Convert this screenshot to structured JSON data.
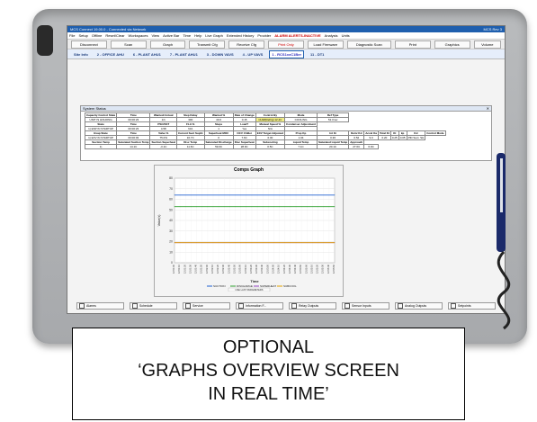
{
  "app": {
    "title": "MCS Connect 19.00.0 - Connected via Network",
    "window_right": "MCS Rev 3"
  },
  "menu": {
    "items": [
      "File",
      "Setup",
      "Offline",
      "Reset/Clear",
      "Workspaces",
      "View",
      "Active Bar",
      "Time",
      "Help",
      "Live Graph",
      "Extended History",
      "Provider"
    ],
    "alarm": "ALARM ALERTS-INACTIVE",
    "right_items": [
      "Analysis",
      "Units"
    ]
  },
  "toolbar": {
    "buttons": [
      "Disconnect",
      "Scan",
      "Graph",
      "Transmit Cfg",
      "Receive Cfg",
      "Print Only",
      "Load Firmware",
      "Diagnostic Scan",
      "Print",
      "Graphics",
      "Volume"
    ]
  },
  "sites": {
    "label": "Site Info",
    "items": [
      "2 - OFFICE AHU",
      "6 - PLANT AHU1",
      "7 - PLANT AHU1",
      "3 - DOWN VAVS",
      "4 - UP VAVS",
      "1 - RCS1xxC1Ber",
      "11 - DT1"
    ]
  },
  "status_panel": {
    "title": "System Status",
    "row1_headers": [
      "Capacity Control State",
      "Time",
      "Wanted/ Actual",
      "Step Delay",
      "Wanted %",
      "Rate of Change",
      "Control By",
      "Mode",
      "Ref Type"
    ],
    "row1_values": [
      "UNIT IS HOLDING",
      "00:00:23",
      "1/1",
      "300",
      "40.0",
      "0.15",
      "CHW(Refrig) 12.4C",
      "COOLING",
      "52.0 kw"
    ],
    "row2_headers": [
      "State",
      "Time",
      "PSC/SST",
      "FLA %",
      "Steps",
      "Load?",
      "Manual Speed %",
      "Condenser Adjustment"
    ],
    "row2_values": [
      "1) ESP IN STARTUP",
      "00:00:23",
      "4.58",
      "N/A",
      "1",
      "Yes",
      "N/A",
      ""
    ],
    "row3_headers": [
      "Evap State",
      "Time",
      "Valve %",
      "Current Suct Supht",
      "Superheat MOC",
      "OCV Chiller",
      "EXV Target Adjusted",
      "Prop Kp",
      "Int Ki",
      "Deriv Kd",
      "Accel Ka",
      "Total Kt",
      "Kt",
      "kp",
      "Kd",
      "Control Mode"
    ],
    "row3_values": [
      "1) EXV IN STARTUP",
      "00:00:03",
      "75.0%",
      "16.7C",
      "0",
      "7.6C",
      "0.00",
      "1.04",
      "0.36",
      "0.52",
      "9.0",
      "0.20",
      "0.25",
      "0.05",
      "PID Suct. SH"
    ],
    "row4_headers": [
      "Suction Temp",
      "Saturated Suction Temp",
      "Suction Superheat",
      "Disc Temp",
      "Saturated Discharge",
      "Disc Superheat",
      "Subcooling",
      "Liquid Temp",
      "Saturated Liquid Temp",
      "Approach"
    ],
    "row4_values": [
      "14.1C",
      "-3.1C",
      "11.6C",
      "59.0C",
      "28.9C",
      "0.5C",
      "7.1C",
      "20.1C",
      "27.6C",
      "6.9C"
    ],
    "row4_index": "1)"
  },
  "chart_data": {
    "type": "line",
    "title": "Comps Graph",
    "xlabel": "Time",
    "ylabel": "Value(s)",
    "x": [
      "12:51:00",
      "12:51:10",
      "12:51:20",
      "12:51:30",
      "12:51:40",
      "12:51:50",
      "12:52:00",
      "12:52:10",
      "12:52:20",
      "12:52:30",
      "12:52:40",
      "12:52:50",
      "12:53:00",
      "12:53:10",
      "12:53:20",
      "12:53:30",
      "12:53:40",
      "12:53:50",
      "12:54:00",
      "12:54:10",
      "12:54:20",
      "12:54:30",
      "12:54:40",
      "12:54:50",
      "12:55:00",
      "12:55:10",
      "12:55:20",
      "12:55:30",
      "12:55:40",
      "12:55:50"
    ],
    "series": [
      {
        "name": "SUCTION",
        "color": "#2060d0",
        "values": [
          64,
          64,
          64,
          64,
          64,
          64,
          64,
          64,
          64,
          64,
          64,
          64,
          64,
          64,
          64,
          64,
          64,
          64,
          64,
          64,
          64,
          64,
          64,
          64,
          64,
          64,
          64,
          64,
          64,
          64
        ]
      },
      {
        "name": "DISCHARGE",
        "color": "#30a030",
        "values": [
          53,
          53,
          53,
          53,
          53,
          53,
          53,
          53,
          53,
          53,
          53,
          53,
          53,
          53,
          53,
          53,
          53,
          53,
          53,
          53,
          53,
          53,
          53,
          53,
          53,
          53,
          53,
          53,
          53,
          53
        ]
      },
      {
        "name": "SUPERHEAT",
        "color": "#9040c0",
        "values": [
          19,
          19,
          19,
          19,
          19,
          19,
          19,
          19,
          19,
          19,
          19,
          19,
          19,
          19,
          19,
          19,
          19,
          19,
          19,
          19,
          19,
          19,
          19,
          19,
          19,
          19,
          19,
          19,
          19,
          19
        ]
      },
      {
        "name": "SUBCOOL",
        "color": "#e0a000",
        "values": [
          19,
          19,
          19,
          19,
          19,
          19,
          19,
          19,
          19,
          19,
          19,
          19,
          19,
          19,
          19,
          19,
          19,
          19,
          19,
          19,
          19,
          19,
          19,
          19,
          19,
          19,
          19,
          19,
          19,
          19
        ]
      }
    ],
    "ylim": [
      0,
      80
    ],
    "yticks": [
      0,
      10,
      20,
      30,
      40,
      50,
      60,
      70,
      80
    ],
    "grid": true,
    "legend_position": "bottom",
    "footer_button": "USE LAST PARAMETERS"
  },
  "bottom_buttons": [
    "Alarms",
    "Schedule",
    "Service",
    "Information F...",
    "Relay Outputs",
    "Sensor Inputs",
    "Analog Outputs",
    "Setpoints"
  ],
  "caption": {
    "line1": "OPTIONAL",
    "line2": "‘GRAPHS OVERVIEW SCREEN",
    "line3": "IN REAL TIME’"
  }
}
